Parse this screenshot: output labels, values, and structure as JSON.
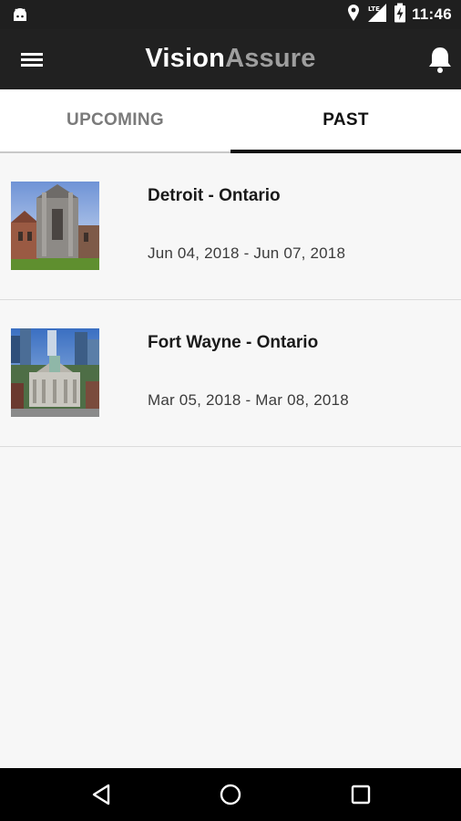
{
  "status_bar": {
    "time": "11:46",
    "icons": [
      "android-debug-icon",
      "location-icon",
      "lte-signal-icon",
      "battery-charging-icon"
    ]
  },
  "app_bar": {
    "title_part1": "Vision",
    "title_part2": "Assure",
    "colors": {
      "title_primary": "#ffffff",
      "title_secondary": "#9e9e9e",
      "background": "#212121"
    }
  },
  "tabs": [
    {
      "label": "UPCOMING",
      "selected": false
    },
    {
      "label": "PAST",
      "selected": true
    }
  ],
  "trips": [
    {
      "title": "Detroit - Ontario",
      "dates": "Jun 04, 2018 - Jun 07, 2018",
      "image": "church-photo"
    },
    {
      "title": "Fort Wayne - Ontario",
      "dates": "Mar 05, 2018 - Mar 08, 2018",
      "image": "courthouse-photo"
    }
  ],
  "nav_bar": {
    "icons": [
      "back-icon",
      "home-icon",
      "recents-icon"
    ]
  }
}
